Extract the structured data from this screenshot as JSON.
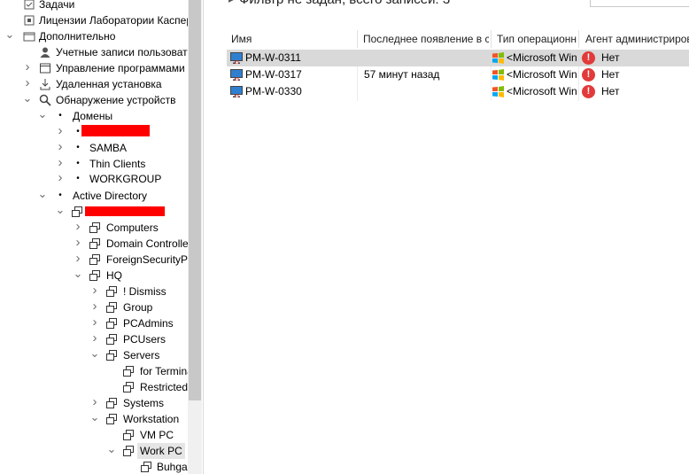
{
  "tree": {
    "items": [
      {
        "label": "Задачи"
      },
      {
        "label": "Лицензии Лаборатории Касперского"
      },
      {
        "label": "Дополнительно"
      },
      {
        "label": "Учетные записи пользователей"
      },
      {
        "label": "Управление программами"
      },
      {
        "label": "Удаленная установка"
      },
      {
        "label": "Обнаружение устройств"
      },
      {
        "label": "Домены"
      },
      {
        "label": ""
      },
      {
        "label": "SAMBA"
      },
      {
        "label": "Thin Clients"
      },
      {
        "label": "WORKGROUP"
      },
      {
        "label": "Active Directory"
      },
      {
        "label": ""
      },
      {
        "label": "Computers"
      },
      {
        "label": "Domain Controllers"
      },
      {
        "label": "ForeignSecurityPrincipals"
      },
      {
        "label": "HQ"
      },
      {
        "label": "! Dismiss"
      },
      {
        "label": "Group"
      },
      {
        "label": "PCAdmins"
      },
      {
        "label": "PCUsers"
      },
      {
        "label": "Servers"
      },
      {
        "label": "for Terminal"
      },
      {
        "label": "Restricted"
      },
      {
        "label": "Systems"
      },
      {
        "label": "Workstation"
      },
      {
        "label": "VM PC"
      },
      {
        "label": "Work PC"
      },
      {
        "label": "Buhgalteria"
      }
    ]
  },
  "list": {
    "filter_text": "Фильтр не задан, всего записей: 3",
    "columns": [
      {
        "label": "Имя"
      },
      {
        "label": "Последнее появление в сети"
      },
      {
        "label": "Тип операционной системы"
      },
      {
        "label": "Агент администрирования"
      }
    ],
    "rows": [
      {
        "name": "PM-W-0311",
        "last_seen": "",
        "os": "<Microsoft Windows>",
        "agent": "Нет"
      },
      {
        "name": "PM-W-0317",
        "last_seen": "57 минут назад",
        "os": "<Microsoft Windows>",
        "agent": "Нет"
      },
      {
        "name": "PM-W-0330",
        "last_seen": "",
        "os": "<Microsoft Windows>",
        "agent": "Нет"
      }
    ]
  },
  "colors": {
    "selection": "#d9d9d9",
    "alert": "#e23a3a",
    "redaction": "#ff0000",
    "monitor_screen": "#2f7fd1"
  },
  "icons": {
    "computer": "computer-icon",
    "windows": "windows-logo-icon",
    "alert": "alert-icon",
    "ad_container": "ad-container-icon",
    "user": "user-icon",
    "apps": "apps-icon",
    "search": "search-icon"
  }
}
